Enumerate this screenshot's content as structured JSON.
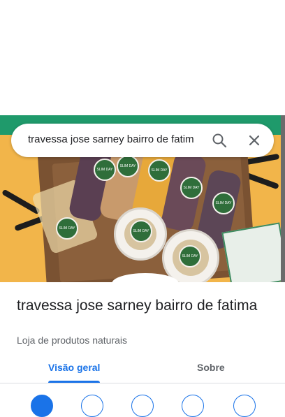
{
  "search": {
    "query": "travessa jose sarney bairro de fatim"
  },
  "hero": {
    "badge_text": "SLIM DAY"
  },
  "place": {
    "title": "travessa jose sarney bairro de fatima",
    "category": "Loja de produtos naturais"
  },
  "tabs": [
    {
      "label": "Visão geral",
      "selected": true
    },
    {
      "label": "Sobre",
      "selected": false
    }
  ],
  "colors": {
    "accent": "#1a73e8",
    "title": "#202124",
    "secondary": "#5f6368"
  }
}
